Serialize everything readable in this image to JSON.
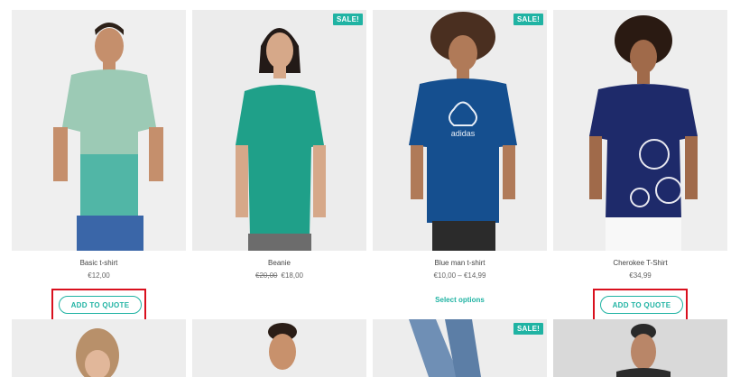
{
  "products": [
    {
      "name": "Basic t-shirt",
      "price": "€12,00",
      "sale": false,
      "action": "ADD TO QUOTE"
    },
    {
      "name": "Beanie",
      "old_price": "€20,00",
      "price": "€18,00",
      "sale": true,
      "sale_label": "SALE!"
    },
    {
      "name": "Blue man t-shirt",
      "price": "€10,00 – €14,99",
      "sale": true,
      "sale_label": "SALE!",
      "action": "Select options"
    },
    {
      "name": "Cherokee T-Shirt",
      "price": "€34,99",
      "sale": false,
      "action": "ADD TO QUOTE"
    }
  ],
  "bottom_row": [
    {
      "sale": false
    },
    {
      "sale": false
    },
    {
      "sale": true,
      "sale_label": "SALE!"
    },
    {
      "sale": false
    }
  ],
  "colors": {
    "accent": "#20b3a3",
    "highlight": "#d9101e",
    "image_bg": "#ededed"
  }
}
